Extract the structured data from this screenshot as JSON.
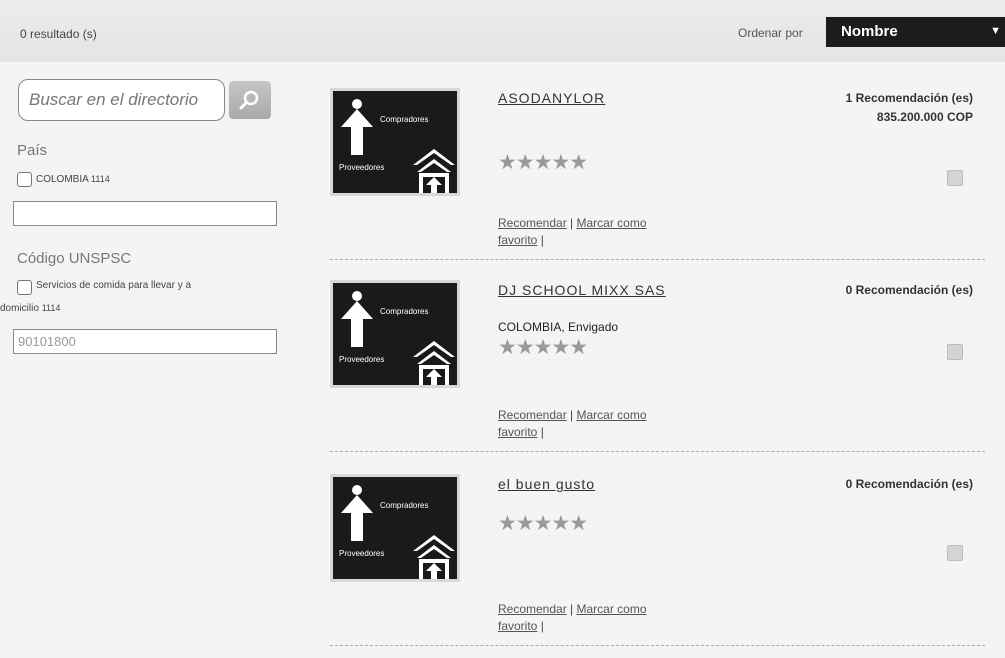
{
  "header": {
    "result_count": "0 resultado (s)",
    "sort_label": "Ordenar por",
    "sort_value": "Nombre"
  },
  "sidebar": {
    "search_placeholder": "Buscar en el directorio",
    "country_heading": "País",
    "country_option": "COLOMBIA",
    "country_count": "1114",
    "country_input": "",
    "unspsc_heading": "Código UNSPSC",
    "unspsc_option_line1": "Servicios de comida para llevar y a",
    "unspsc_option_line2": "domicilio",
    "unspsc_count": "1114",
    "unspsc_input": "90101800"
  },
  "logo": {
    "top_text": "Compradores",
    "bottom_text": "Proveedores"
  },
  "results": [
    {
      "name": "ASODANYLOR",
      "location": "",
      "recommendations": "1 Recomendación (es)",
      "amount": "835.200.000 COP",
      "stars": "★★★★★"
    },
    {
      "name": "DJ SCHOOL MIXX SAS",
      "location": "COLOMBIA, Envigado",
      "recommendations": "0 Recomendación (es)",
      "amount": "",
      "stars": "★★★★★"
    },
    {
      "name": "el buen gusto",
      "location": "",
      "recommendations": "0 Recomendación (es)",
      "amount": "",
      "stars": "★★★★★"
    }
  ],
  "actions": {
    "recommend": "Recomendar",
    "favorite_line1": "Marcar como",
    "favorite_line2": "favorito",
    "separator": "|"
  },
  "icons": {
    "search": "search-icon",
    "sort_caret": "chevron-down-icon",
    "favorite": "checkbox-icon"
  }
}
